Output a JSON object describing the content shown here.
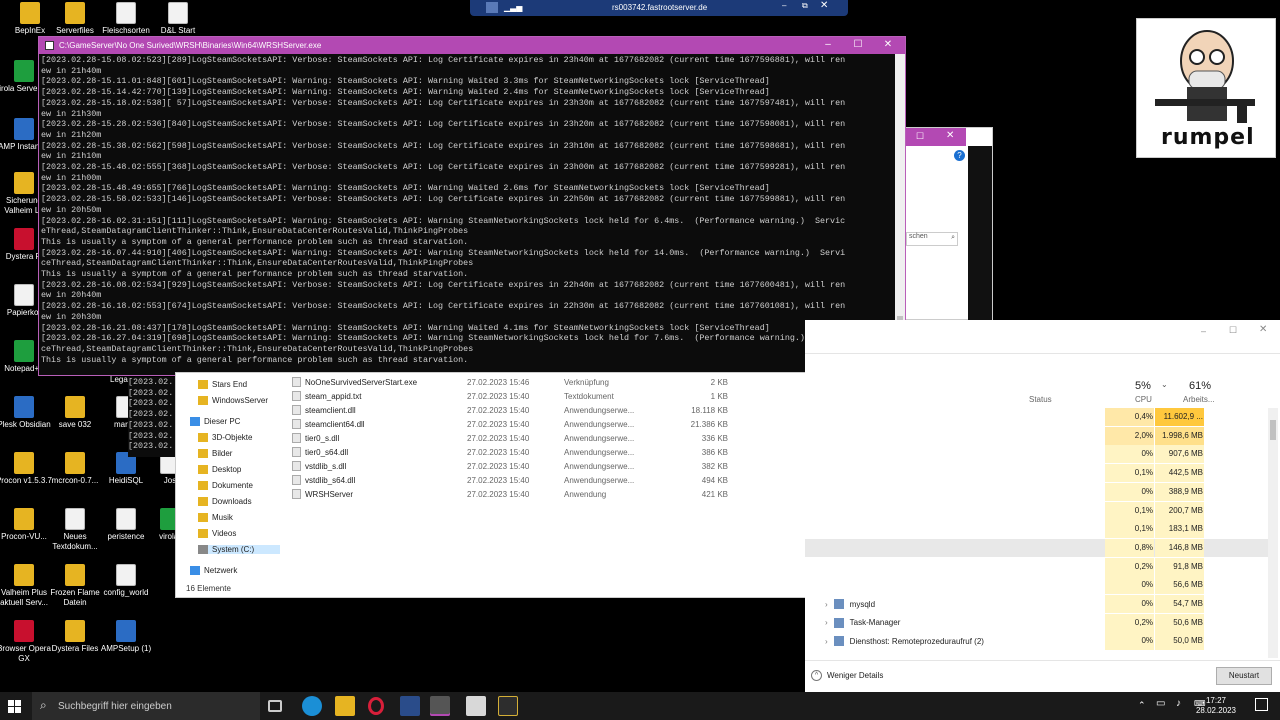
{
  "rdp_bar": {
    "host": "rs003742.fastrootserver.de"
  },
  "console": {
    "title": "C:\\GameServer\\No One Surived\\WRSH\\Binaries\\Win64\\WRSHServer.exe",
    "lines": [
      "[2023.02.28-15.08.02:523][289]LogSteamSocketsAPI: Verbose: SteamSockets API: Log Certificate expires in 23h40m at 1677682082 (current time 1677596881), will ren",
      "ew in 21h40m",
      "[2023.02.28-15.11.01:848][601]LogSteamSocketsAPI: Warning: SteamSockets API: Warning Waited 3.3ms for SteamNetworkingSockets lock [ServiceThread]",
      "[2023.02.28-15.14.42:770][139]LogSteamSocketsAPI: Warning: SteamSockets API: Warning Waited 2.4ms for SteamNetworkingSockets lock [ServiceThread]",
      "[2023.02.28-15.18.02:538][ 57]LogSteamSocketsAPI: Verbose: SteamSockets API: Log Certificate expires in 23h30m at 1677682082 (current time 1677597481), will ren",
      "ew in 21h30m",
      "[2023.02.28-15.28.02:536][840]LogSteamSocketsAPI: Verbose: SteamSockets API: Log Certificate expires in 23h20m at 1677682082 (current time 1677598081), will ren",
      "ew in 21h20m",
      "[2023.02.28-15.38.02:562][598]LogSteamSocketsAPI: Verbose: SteamSockets API: Log Certificate expires in 23h10m at 1677682082 (current time 1677598681), will ren",
      "ew in 21h10m",
      "[2023.02.28-15.48.02:555][368]LogSteamSocketsAPI: Verbose: SteamSockets API: Log Certificate expires in 23h00m at 1677682082 (current time 1677599281), will ren",
      "ew in 21h00m",
      "[2023.02.28-15.48.49:655][766]LogSteamSocketsAPI: Warning: SteamSockets API: Warning Waited 2.6ms for SteamNetworkingSockets lock [ServiceThread]",
      "[2023.02.28-15.58.02:533][146]LogSteamSocketsAPI: Verbose: SteamSockets API: Log Certificate expires in 22h50m at 1677682082 (current time 1677599881), will ren",
      "ew in 20h50m",
      "[2023.02.28-16.02.31:151][111]LogSteamSocketsAPI: Warning: SteamSockets API: Warning SteamNetworkingSockets lock held for 6.4ms.  (Performance warning.)  Servic",
      "eThread,SteamDatagramClientThinker::Think,EnsureDataCenterRoutesValid,ThinkPingProbes",
      "This is usually a symptom of a general performance problem such as thread starvation.",
      "[2023.02.28-16.07.44:910][406]LogSteamSocketsAPI: Warning: SteamSockets API: Warning SteamNetworkingSockets lock held for 14.0ms.  (Performance warning.)  Servi",
      "ceThread,SteamDatagramClientThinker::Think,EnsureDataCenterRoutesValid,ThinkPingProbes",
      "This is usually a symptom of a general performance problem such as thread starvation.",
      "[2023.02.28-16.08.02:534][929]LogSteamSocketsAPI: Verbose: SteamSockets API: Log Certificate expires in 22h40m at 1677682082 (current time 1677600481), will ren",
      "ew in 20h40m",
      "[2023.02.28-16.18.02:553][674]LogSteamSocketsAPI: Verbose: SteamSockets API: Log Certificate expires in 22h30m at 1677682082 (current time 1677601081), will ren",
      "ew in 20h30m",
      "[2023.02.28-16.21.08:437][178]LogSteamSocketsAPI: Warning: SteamSockets API: Warning Waited 4.1ms for SteamNetworkingSockets lock [ServiceThread]",
      "[2023.02.28-16.27.04:319][698]LogSteamSocketsAPI: Warning: SteamSockets API: Warning SteamNetworkingSockets lock held for 7.6ms.  (Performance warning.)  Servi",
      "ceThread,SteamDatagramClientThinker::Think,EnsureDataCenterRoutesValid,ThinkPingProbes",
      "This is usually a symptom of a general performance problem such as thread starvation."
    ]
  },
  "bg_console": {
    "label": "Lega",
    "lines": [
      "[2023.02.",
      "[2023.02.",
      "[2023.02.",
      "[2023.02.",
      "[2023.02.",
      "[2023.02.",
      "[2023.02."
    ]
  },
  "desktop_icons": [
    {
      "label": "BepInEx",
      "kind": "folder"
    },
    {
      "label": "Serverfiles",
      "kind": "folder"
    },
    {
      "label": "Fleischsorten",
      "kind": "doc"
    },
    {
      "label": "D&L Start",
      "kind": "doc"
    },
    {
      "label": "Virola Serve GUI",
      "kind": "app-green"
    },
    {
      "label": "AMP Instanc...",
      "kind": "app-blue"
    },
    {
      "label": "Sicherung Valheim Le",
      "kind": "folder"
    },
    {
      "label": "Dystera Fi",
      "kind": "app-red"
    },
    {
      "label": "Papierkor",
      "kind": "doc"
    },
    {
      "label": "Notepad++",
      "kind": "app-green"
    },
    {
      "label": "Plesk Obsidian",
      "kind": "app-blue"
    },
    {
      "label": "save 032",
      "kind": "folder"
    },
    {
      "label": "mariac",
      "kind": "doc"
    },
    {
      "label": "Procon v1.5.3.7",
      "kind": "folder"
    },
    {
      "label": "mcrcon-0.7...",
      "kind": "folder"
    },
    {
      "label": "HeidiSQL",
      "kind": "app-blue"
    },
    {
      "label": "Jos",
      "kind": "doc"
    },
    {
      "label": "Procon-VU...",
      "kind": "folder"
    },
    {
      "label": "Neues Textdokum...",
      "kind": "doc"
    },
    {
      "label": "peristence",
      "kind": "doc"
    },
    {
      "label": "virola-",
      "kind": "app-green"
    },
    {
      "label": "Valheim Plus aktuell Serv...",
      "kind": "folder"
    },
    {
      "label": "Frozen Flame Datein",
      "kind": "folder"
    },
    {
      "label": "config_world",
      "kind": "doc"
    },
    {
      "label": "Browser Opera GX",
      "kind": "app-red"
    },
    {
      "label": "Dystera Files",
      "kind": "folder"
    },
    {
      "label": "AMPSetup (1)",
      "kind": "app-blue"
    }
  ],
  "explorer": {
    "nav": [
      {
        "label": "Stars End",
        "kind": "folder"
      },
      {
        "label": "WindowsServer",
        "kind": "folder"
      },
      {
        "label": "Dieser PC",
        "kind": "pc"
      },
      {
        "label": "3D-Objekte",
        "kind": "folder"
      },
      {
        "label": "Bilder",
        "kind": "folder"
      },
      {
        "label": "Desktop",
        "kind": "folder"
      },
      {
        "label": "Dokumente",
        "kind": "folder"
      },
      {
        "label": "Downloads",
        "kind": "folder"
      },
      {
        "label": "Musik",
        "kind": "folder"
      },
      {
        "label": "Videos",
        "kind": "folder"
      },
      {
        "label": "System (C:)",
        "kind": "drive"
      },
      {
        "label": "Netzwerk",
        "kind": "net"
      }
    ],
    "files": [
      {
        "name": "NoOneSurvivedServerStart.exe",
        "date": "27.02.2023 15:46",
        "type": "Verknüpfung",
        "size": "2 KB"
      },
      {
        "name": "steam_appid.txt",
        "date": "27.02.2023 15:40",
        "type": "Textdokument",
        "size": "1 KB"
      },
      {
        "name": "steamclient.dll",
        "date": "27.02.2023 15:40",
        "type": "Anwendungserwe...",
        "size": "18.118 KB"
      },
      {
        "name": "steamclient64.dll",
        "date": "27.02.2023 15:40",
        "type": "Anwendungserwe...",
        "size": "21.386 KB"
      },
      {
        "name": "tier0_s.dll",
        "date": "27.02.2023 15:40",
        "type": "Anwendungserwe...",
        "size": "336 KB"
      },
      {
        "name": "tier0_s64.dll",
        "date": "27.02.2023 15:40",
        "type": "Anwendungserwe...",
        "size": "386 KB"
      },
      {
        "name": "vstdlib_s.dll",
        "date": "27.02.2023 15:40",
        "type": "Anwendungserwe...",
        "size": "382 KB"
      },
      {
        "name": "vstdlib_s64.dll",
        "date": "27.02.2023 15:40",
        "type": "Anwendungserwe...",
        "size": "494 KB"
      },
      {
        "name": "WRSHServer",
        "date": "27.02.2023 15:40",
        "type": "Anwendung",
        "size": "421 KB"
      }
    ],
    "status": "16 Elemente"
  },
  "side_dialog": {
    "search_placeholder": "schen"
  },
  "task_manager": {
    "cpu_pct": "5%",
    "mem_pct": "61%",
    "col_status": "Status",
    "col_cpu": "CPU",
    "col_mem": "Arbeits...",
    "rows": [
      {
        "name": "",
        "cpu": "0,4%",
        "mem": "11.602,9 ..."
      },
      {
        "name": "",
        "cpu": "2,0%",
        "mem": "1.998,6 MB"
      },
      {
        "name": "",
        "cpu": "0%",
        "mem": "907,6 MB"
      },
      {
        "name": "",
        "cpu": "0,1%",
        "mem": "442,5 MB"
      },
      {
        "name": "",
        "cpu": "0%",
        "mem": "388,9 MB"
      },
      {
        "name": "",
        "cpu": "0,1%",
        "mem": "200,7 MB"
      },
      {
        "name": "",
        "cpu": "0,1%",
        "mem": "183,1 MB"
      },
      {
        "name": "",
        "cpu": "0,8%",
        "mem": "146,8 MB"
      },
      {
        "name": "",
        "cpu": "0,2%",
        "mem": "91,8 MB"
      },
      {
        "name": "",
        "cpu": "0%",
        "mem": "56,6 MB"
      },
      {
        "name": "mysqld",
        "cpu": "0%",
        "mem": "54,7 MB"
      },
      {
        "name": "Task-Manager",
        "cpu": "0,2%",
        "mem": "50,6 MB"
      },
      {
        "name": "Diensthost: Remoteprozeduraufruf (2)",
        "cpu": "0%",
        "mem": "50,0 MB"
      }
    ],
    "fewer_details": "Weniger Details",
    "restart": "Neustart"
  },
  "avatar": {
    "caption": "rumpel"
  },
  "taskbar": {
    "search_placeholder": "Suchbegriff hier eingeben",
    "time": "17:27",
    "date": "28.02.2023"
  },
  "colors": {
    "console_title": "#b349b3",
    "rdp_bar": "#1c3a78",
    "cpu_highlight": "#fff4c4",
    "mem_highlight": "#ffd54f"
  }
}
